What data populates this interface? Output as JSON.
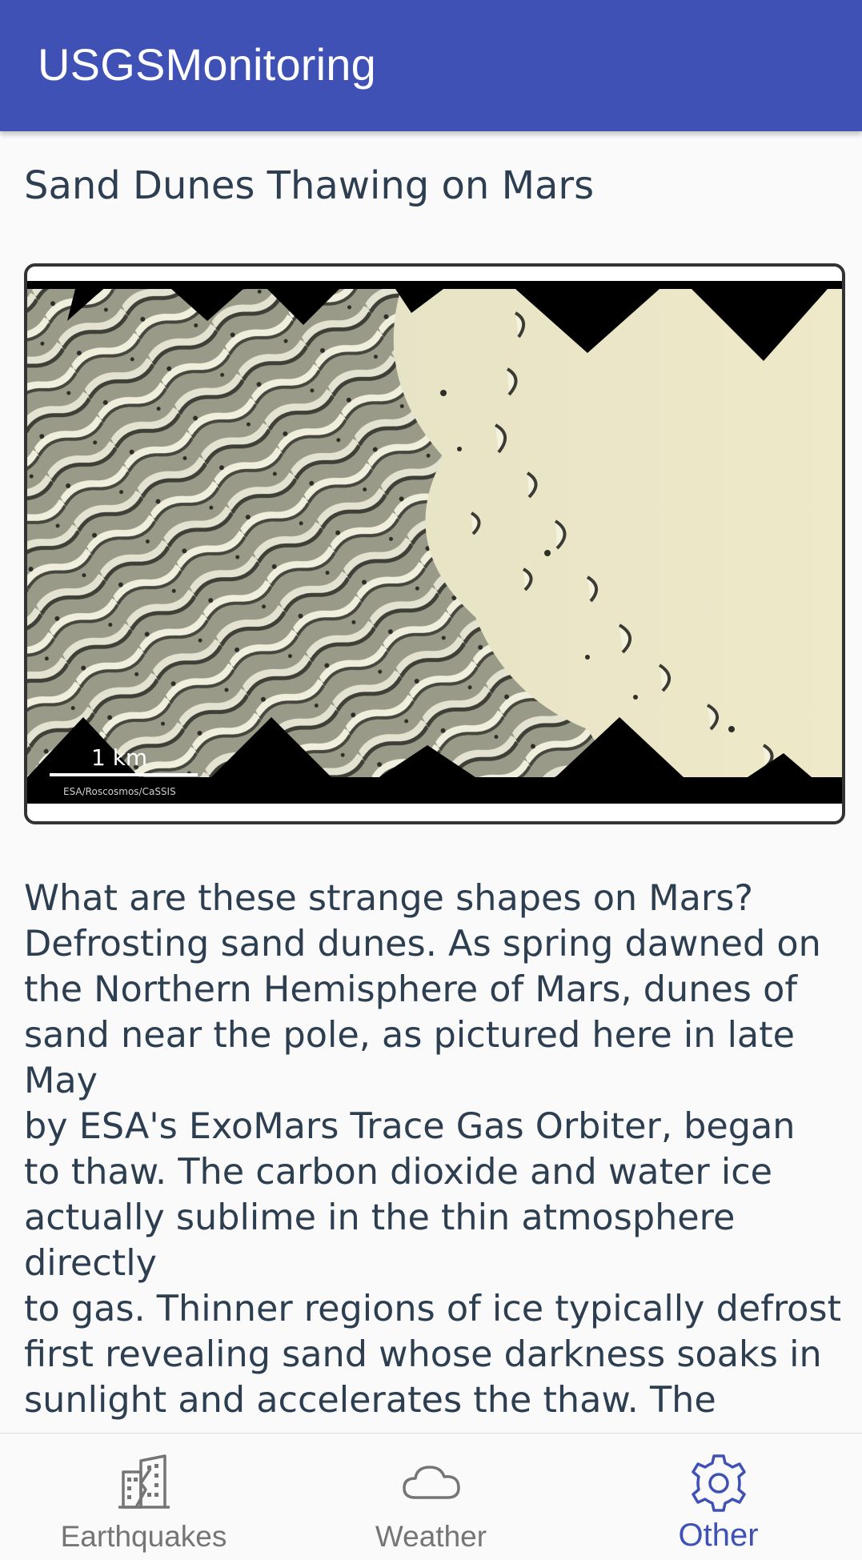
{
  "app": {
    "title": "USGSMonitoring",
    "accent_color": "#3f51b5"
  },
  "article": {
    "title": "Sand Dunes Thawing on Mars",
    "image": {
      "scale_label": "1 km",
      "credit": "ESA/Roscosmos/CaSSIS"
    },
    "body": "What are these strange shapes on Mars?\nDefrosting sand dunes. As spring dawned on\nthe Northern Hemisphere of Mars, dunes of\nsand near the pole, as pictured here in late May\nby ESA's ExoMars Trace Gas Orbiter, began\nto thaw.  The carbon dioxide and water ice\nactually sublime in the thin atmosphere directly\nto gas.  Thinner regions of ice typically defrost\nfirst revealing sand whose darkness soaks in\nsunlight and accelerates the thaw.  The process\nmight even involve sandy jets exploding\nthrough the thinning ice.  By summer, spots will\n"
  },
  "bottom_nav": {
    "items": [
      {
        "label": "Earthquakes",
        "icon": "building-icon",
        "active": false
      },
      {
        "label": "Weather",
        "icon": "cloud-icon",
        "active": false
      },
      {
        "label": "Other",
        "icon": "gear-icon",
        "active": true
      }
    ],
    "active_color": "#3f51b5",
    "inactive_color": "#757575"
  }
}
